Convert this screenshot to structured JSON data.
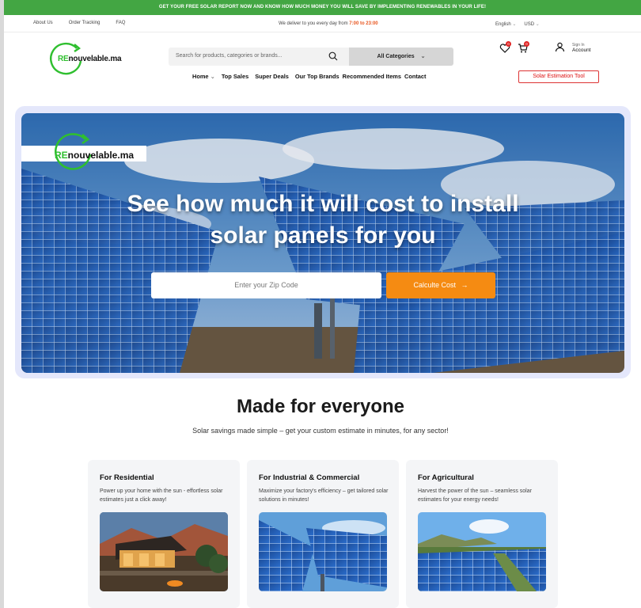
{
  "promo": {
    "text": "GET YOUR FREE SOLAR REPORT NOW AND KNOW HOW MUCH MONEY YOU WILL SAVE BY IMPLEMENTING RENEWABLES IN YOUR LIFE!"
  },
  "utility": {
    "links": [
      "About Us",
      "Order Tracking",
      "FAQ"
    ],
    "delivery_prefix": "We deliver to you every day from ",
    "delivery_hours": "7:00 to 23:00",
    "language": "English",
    "currency": "USD"
  },
  "brand": {
    "prefix": "RE",
    "suffix": "nouvelable.ma",
    "color": "#2fbf2f"
  },
  "hero_brand": {
    "prefix": "RE",
    "suffix": "nouvelable.ma"
  },
  "search": {
    "placeholder": "Search for products, categories or brands...",
    "category": "All Categories"
  },
  "nav": [
    "Home",
    "Top Sales",
    "Super Deals",
    "Our Top Brands",
    "Recommended Items",
    "Contact"
  ],
  "header_icons": {
    "wishlist_count": "0",
    "cart_count": "0",
    "wishlist_icon": "heart-icon",
    "cart_icon": "cart-icon"
  },
  "account": {
    "sign_in": "Sign In",
    "label": "Account"
  },
  "solar_tool": "Solar Estimation Tool",
  "hero": {
    "title_line1": "See how much it will cost to install",
    "title_line2": "solar panels for you",
    "zip_placeholder": "Enter your Zip Code",
    "cta": "Calculte Cost",
    "cta_color": "#f58b12"
  },
  "section": {
    "title": "Made for everyone",
    "subtitle": "Solar savings made simple – get your custom estimate in minutes, for any sector!"
  },
  "cards": [
    {
      "title": "For Residential",
      "desc": "Power up your home with the sun - effortless solar estimates just a click away!"
    },
    {
      "title": "For Industrial & Commercial",
      "desc": "Maximize your factory's efficiency – get tailored solar solutions in minutes!"
    },
    {
      "title": "For Agricultural",
      "desc": "Harvest the power of the sun – seamless solar estimates for your energy needs!"
    }
  ],
  "colors": {
    "topbar": "#43a643",
    "accent_orange": "#f58b12",
    "deliver_highlight": "#e8561f",
    "badge": "#e02424"
  }
}
